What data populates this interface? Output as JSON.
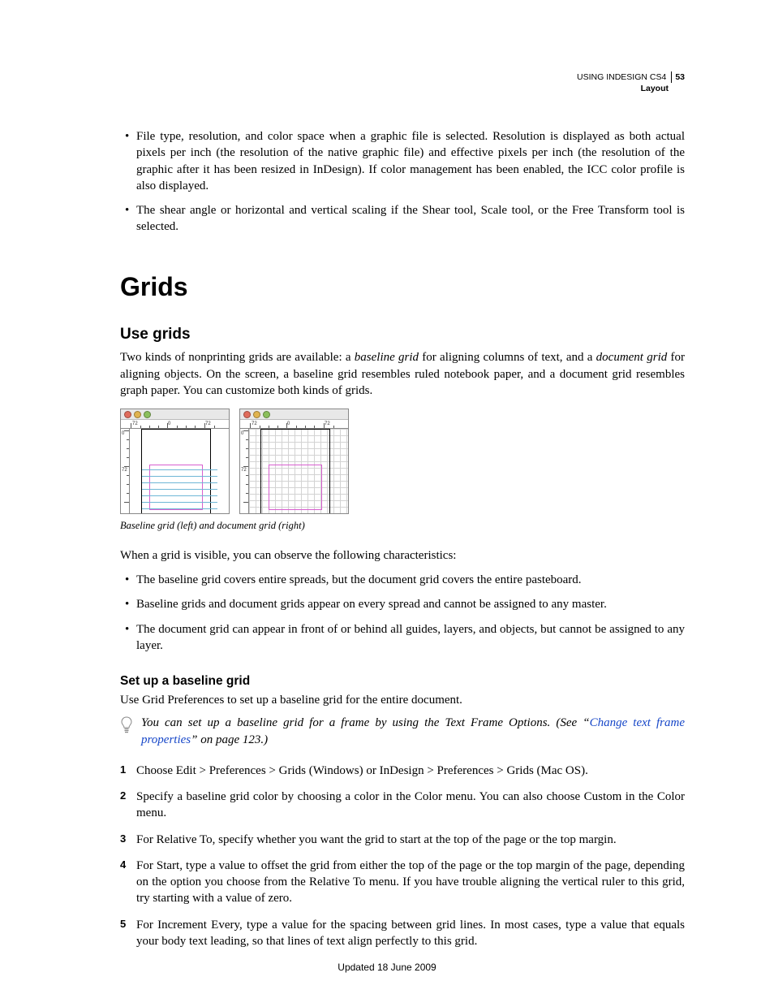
{
  "header": {
    "doc_title": "USING INDESIGN CS4",
    "section": "Layout",
    "page_number": "53"
  },
  "intro_bullets": [
    "File type, resolution, and color space when a graphic file is selected. Resolution is displayed as both actual pixels per inch (the resolution of the native graphic file) and effective pixels per inch (the resolution of the graphic after it has been resized in InDesign). If color management has been enabled, the ICC color profile is also displayed.",
    "The shear angle or horizontal and vertical scaling if the Shear tool, Scale tool, or the Free Transform tool is selected."
  ],
  "chapter_title": "Grids",
  "section_title": "Use grids",
  "intro_para_parts": {
    "p1a": "Two kinds of nonprinting grids are available: a ",
    "p1b": "baseline grid",
    "p1c": " for aligning columns of text, and a ",
    "p1d": "document grid",
    "p1e": " for aligning objects. On the screen, a baseline grid resembles ruled notebook paper, and a document grid resembles graph paper. You can customize both kinds of grids."
  },
  "figure_caption": "Baseline grid (left) and document grid (right)",
  "ruler_labels": {
    "neg72": "72",
    "zero": "0",
    "pos72": "72"
  },
  "char_para": "When a grid is visible, you can observe the following characteristics:",
  "char_bullets": [
    "The baseline grid covers entire spreads, but the document grid covers the entire pasteboard.",
    "Baseline grids and document grids appear on every spread and cannot be assigned to any master.",
    "The document grid can appear in front of or behind all guides, layers, and objects, but cannot be assigned to any layer."
  ],
  "subsection_title": "Set up a baseline grid",
  "sub_intro": "Use Grid Preferences to set up a baseline grid for the entire document.",
  "tip": {
    "a": "You can set up a baseline grid for a frame by using the Text Frame Options. (See “",
    "link": "Change text frame properties",
    "b": "” on page 123.)"
  },
  "steps": [
    "Choose Edit > Preferences > Grids (Windows) or InDesign > Preferences > Grids (Mac OS).",
    "Specify a baseline grid color by choosing a color in the Color menu. You can also choose Custom in the Color menu.",
    "For Relative To, specify whether you want the grid to start at the top of the page or the top margin.",
    "For Start, type a value to offset the grid from either the top of the page or the top margin of the page, depending on the option you choose from the Relative To menu. If you have trouble aligning the vertical ruler to this grid, try starting with a value of zero.",
    "For Increment Every, type a value for the spacing between grid lines. In most cases, type a value that equals your body text leading, so that lines of text align perfectly to this grid."
  ],
  "footer": "Updated 18 June 2009"
}
